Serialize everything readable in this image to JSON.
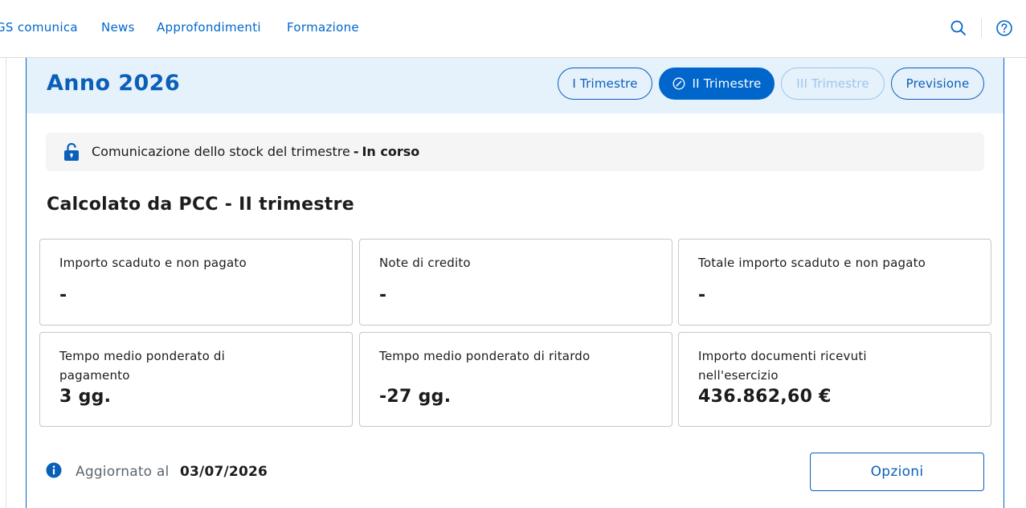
{
  "nav": {
    "links": [
      "GS comunica",
      "News",
      "Approfondimenti",
      "Formazione"
    ],
    "search_icon": "search-icon",
    "help_icon": "help-circle-icon"
  },
  "card": {
    "year_title": "Anno 2026",
    "quarter_tabs": [
      {
        "label": "I Trimestre",
        "state": "default"
      },
      {
        "label": "II Trimestre",
        "state": "active",
        "icon": "edit-circle-icon"
      },
      {
        "label": "III Trimestre",
        "state": "disabled"
      },
      {
        "label": "Previsione",
        "state": "default"
      }
    ]
  },
  "status": {
    "icon": "lock-open-icon",
    "text": "Comunicazione dello stock del trimestre",
    "separator": "-",
    "state": "In corso"
  },
  "section_title": "Calcolato da PCC - II trimestre",
  "metrics": [
    {
      "label": "Importo scaduto e non pagato",
      "value": "-"
    },
    {
      "label": "Note di credito",
      "value": "-"
    },
    {
      "label": "Totale importo scaduto e non pagato",
      "value": "-"
    },
    {
      "label": "Tempo medio ponderato di pagamento",
      "value": "3 gg."
    },
    {
      "label": "Tempo medio ponderato di ritardo",
      "value": "-27 gg."
    },
    {
      "label": "Importo documenti ricevuti nell'esercizio",
      "value": "436.862,60 €"
    }
  ],
  "footer": {
    "info_icon": "info-circle-icon",
    "updated_label": "Aggiornato al",
    "updated_date": "03/07/2026",
    "options_label": "Opzioni"
  },
  "colors": {
    "primary": "#0066cc",
    "header_bg": "#e5f1fb",
    "disabled": "#9cc6ec",
    "status_bg": "#f5f5f5",
    "tile_border": "#c5c7c9"
  }
}
